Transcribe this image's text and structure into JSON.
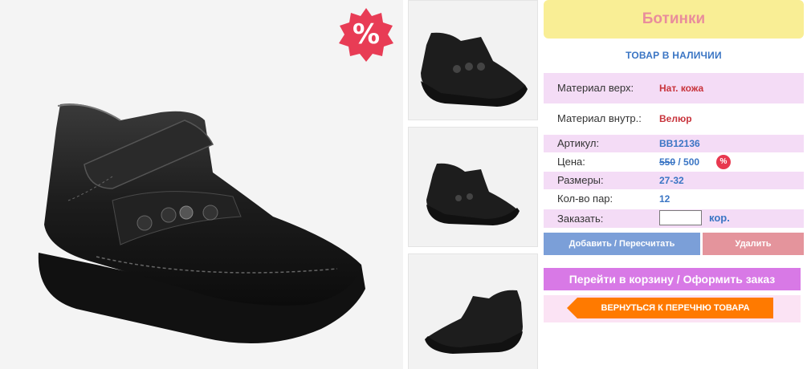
{
  "product": {
    "title": "Ботинки",
    "stock_status": "ТОВАР В НАЛИЧИИ",
    "sale_badge": "%"
  },
  "details": {
    "material_top_label": "Материал верх:",
    "material_top_value": "Нат. кожа",
    "material_inner_label": "Материал внутр.:",
    "material_inner_value": "Велюр",
    "article_label": "Артикул:",
    "article_value": "BB12136",
    "price_label": "Цена:",
    "price_old": "550",
    "price_separator": " / ",
    "price_new": "500",
    "price_badge": "%",
    "sizes_label": "Размеры:",
    "sizes_value": "27-32",
    "pairs_label": "Кол-во пар:",
    "pairs_value": "12",
    "order_label": "Заказать:",
    "order_value": "",
    "order_unit": "кор."
  },
  "actions": {
    "add_label": "Добавить / Пересчитать",
    "delete_label": "Удалить",
    "cart_label": "Перейти в корзину / Оформить заказ",
    "back_label": "ВЕРНУТЬСЯ К ПЕРЕЧНЮ ТОВАРА"
  },
  "colors": {
    "title_bg": "#f9ee95",
    "title_text": "#e98d9c",
    "accent_blue": "#3a75c4",
    "accent_red": "#c8343c",
    "row_pink": "#f4dcf6",
    "add_button": "#7b9fd8",
    "delete_button": "#e4949c",
    "cart_button": "#d879e6",
    "back_button": "#ff7a00"
  },
  "icons": {
    "sale": "percent-badge-icon",
    "back": "arrow-left-icon"
  }
}
